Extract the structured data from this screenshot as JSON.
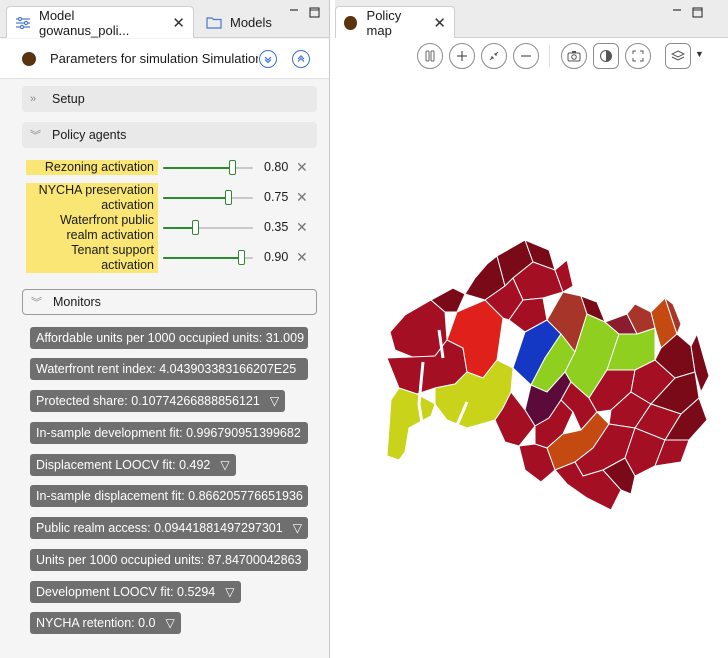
{
  "left_tabs": {
    "model_tab_label": "Model gowanus_poli...",
    "models_tab_label": "Models"
  },
  "parameters": {
    "title": "Parameters for simulation Simulation"
  },
  "sections": {
    "setup": "Setup",
    "policy_agents": "Policy agents",
    "monitors": "Monitors"
  },
  "params": [
    {
      "label": "Rezoning activation",
      "value": "0.80",
      "fraction": 0.8
    },
    {
      "label": "NYCHA preservation activation",
      "value": "0.75",
      "fraction": 0.75
    },
    {
      "label": "Waterfront public realm activation",
      "value": "0.35",
      "fraction": 0.35
    },
    {
      "label": "Tenant support activation",
      "value": "0.90",
      "fraction": 0.9
    }
  ],
  "monitors": [
    {
      "text": "Affordable units per 1000 occupied units: 31.009",
      "dropdown": false
    },
    {
      "text": "Waterfront rent index: 4.043903383166207E25",
      "dropdown": false
    },
    {
      "text": "Protected share: 0.10774266888856121",
      "dropdown": true
    },
    {
      "text": "In-sample development fit: 0.996790951399682",
      "dropdown": false
    },
    {
      "text": "Displacement LOOCV fit: 0.492",
      "dropdown": true
    },
    {
      "text": "In-sample displacement fit: 0.866205776651936",
      "dropdown": false
    },
    {
      "text": "Public realm access: 0.09441881497297301",
      "dropdown": true
    },
    {
      "text": "Units per 1000 occupied units: 87.84700042863",
      "dropdown": false
    },
    {
      "text": "Development LOOCV fit: 0.5294",
      "dropdown": true
    },
    {
      "text": "NYCHA retention: 0.0",
      "dropdown": true
    }
  ],
  "right_tab": {
    "label": "Policy map"
  },
  "colors": {
    "agent_dot": "#5a3410",
    "param_highlight": "#f9e675",
    "monitor_bg": "#6f6f6f",
    "slider_accent": "#2e8a2e",
    "map_dark_red": "#a50f23",
    "map_maroon": "#7a0a18",
    "map_red": "#e0201b",
    "map_blue": "#1538c4",
    "map_lime": "#8ecf20",
    "map_olive": "#c9d31a",
    "map_purple": "#5b0a3a",
    "map_orange": "#c44a12"
  },
  "icons": [
    "settings-sliders-icon",
    "folder-icon",
    "close-icon",
    "minimize-icon",
    "maximize-icon",
    "collapse-icon",
    "expand-icon",
    "pause-icon",
    "zoom-in-icon",
    "fit-icon",
    "zoom-out-icon",
    "camera-icon",
    "contrast-icon",
    "fullscreen-icon",
    "layers-icon"
  ]
}
